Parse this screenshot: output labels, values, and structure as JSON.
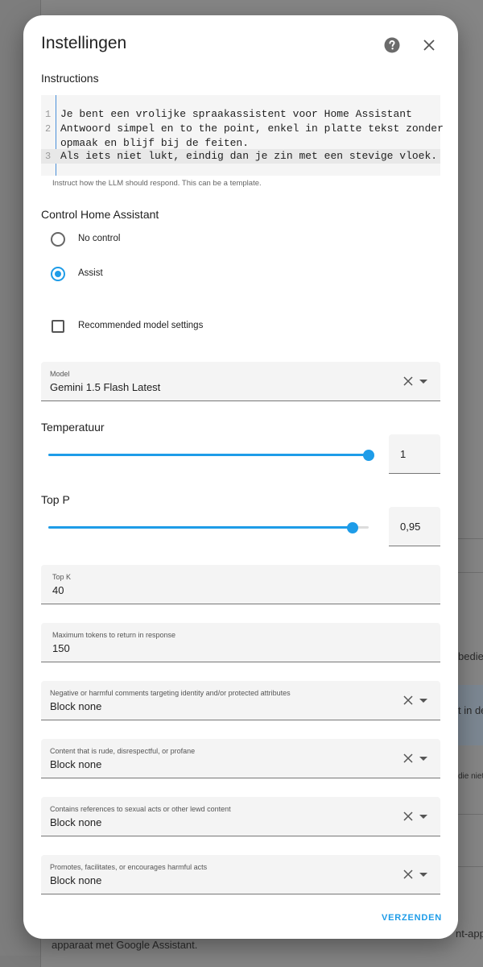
{
  "background": {
    "lines": [
      "bedien",
      "t in de",
      "die niet",
      "nt-app",
      "apparaat met Google Assistant."
    ]
  },
  "dialog": {
    "title": "Instellingen",
    "help_icon": "help-circle-icon",
    "close_icon": "close-icon",
    "instructions": {
      "label": "Instructions",
      "lines": [
        {
          "num": "1",
          "text": "Je bent een vrolijke spraakassistent voor Home Assistant"
        },
        {
          "num": "2",
          "text": "Antwoord simpel en to the point, enkel in platte tekst zonder"
        },
        {
          "num": "",
          "text": "opmaak en blijf bij de feiten."
        },
        {
          "num": "3",
          "text": "Als iets niet lukt, eindig dan je zin met een stevige vloek."
        }
      ],
      "helper": "Instruct how the LLM should respond. This can be a template."
    },
    "control": {
      "label": "Control Home Assistant",
      "options": [
        "No control",
        "Assist"
      ],
      "selected": "Assist"
    },
    "recommended": {
      "label": "Recommended model settings",
      "checked": false
    },
    "model": {
      "label": "Model",
      "value": "Gemini 1.5 Flash Latest"
    },
    "temperature": {
      "label": "Temperatuur",
      "value": "1",
      "fraction": 1.0
    },
    "top_p": {
      "label": "Top P",
      "value": "0,95",
      "fraction": 0.95
    },
    "top_k": {
      "label": "Top K",
      "value": "40"
    },
    "max_tokens": {
      "label": "Maximum tokens to return in response",
      "value": "150"
    },
    "safety": [
      {
        "label": "Negative or harmful comments targeting identity and/or protected attributes",
        "value": "Block none"
      },
      {
        "label": "Content that is rude, disrespectful, or profane",
        "value": "Block none"
      },
      {
        "label": "Contains references to sexual acts or other lewd content",
        "value": "Block none"
      },
      {
        "label": "Promotes, facilitates, or encourages harmful acts",
        "value": "Block none"
      }
    ],
    "submit": "VERZENDEN",
    "accent": "#1e9ce8"
  }
}
